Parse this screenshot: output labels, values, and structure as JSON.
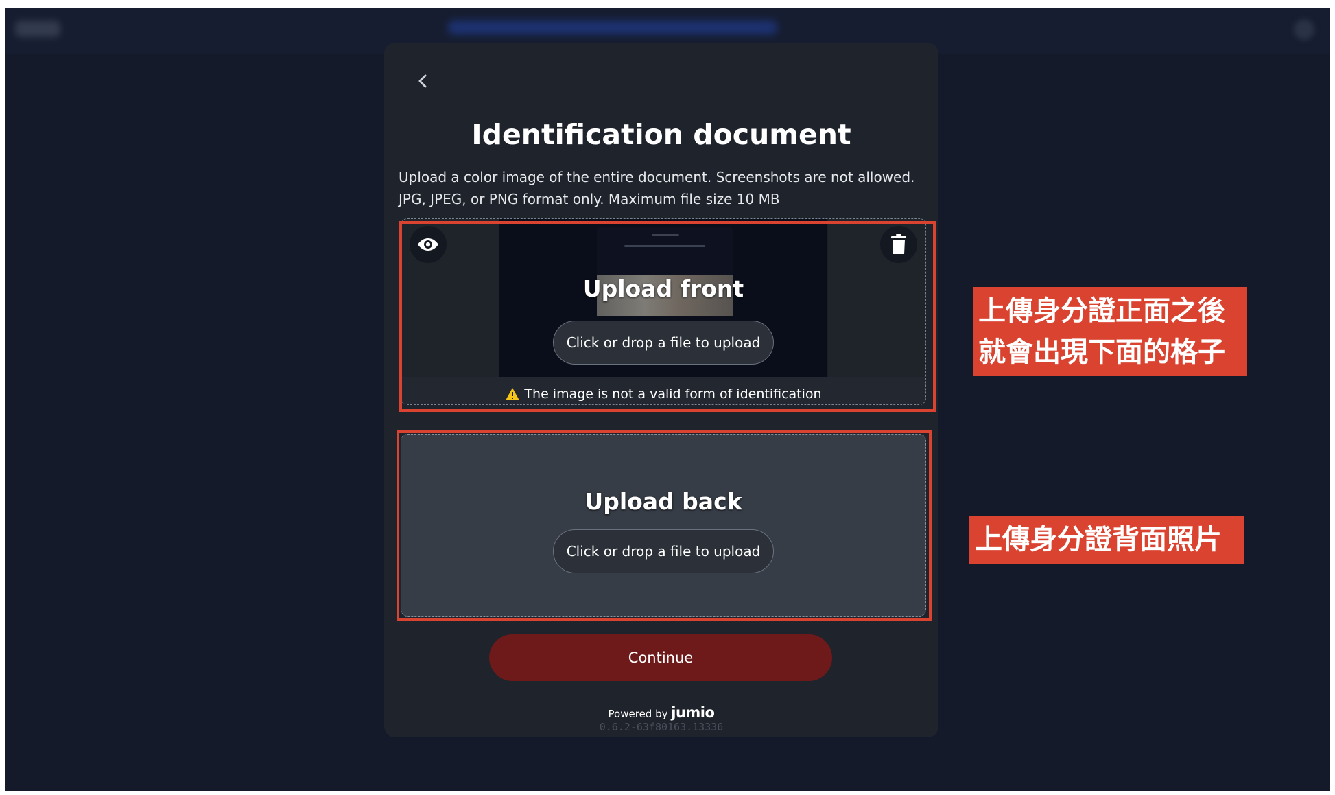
{
  "window": {
    "title": "Identification document"
  },
  "header": {
    "back_icon": "chevron-left-icon"
  },
  "description": {
    "line1": "Upload a color image of the entire document. Screenshots are not allowed.",
    "line2": "JPG, JPEG, or PNG format only. Maximum file size 10 MB"
  },
  "front_zone": {
    "title": "Upload front",
    "button_label": "Click or drop a file to upload",
    "warning_text": "The image is not a valid form of identification",
    "preview_icon": "eye-icon",
    "delete_icon": "trash-icon",
    "warning_icon": "warning-triangle-icon"
  },
  "back_zone": {
    "title": "Upload back",
    "button_label": "Click or drop a file to upload"
  },
  "footer": {
    "continue_label": "Continue",
    "powered_by": "Powered by",
    "brand": "jumio",
    "version": "0.6.2-63f80163.13336"
  },
  "annotations": {
    "callout_front_line1": "上傳身分證正面之後",
    "callout_front_line2": "就會出現下面的格子",
    "callout_back": "上傳身分證背面照片"
  },
  "colors": {
    "page_background": "#141a2a",
    "modal_background": "#1f232b",
    "continue_button": "#6e1a1a",
    "annotation_red": "#d9432f",
    "warning_yellow": "#f5c518"
  }
}
